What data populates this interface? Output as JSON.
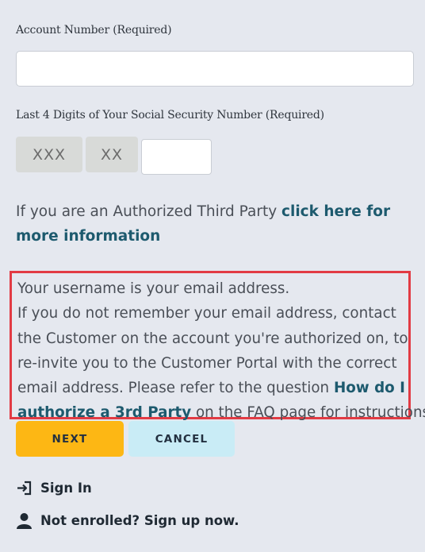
{
  "form": {
    "account_label": "Account Number (Required)",
    "ssn_label": "Last 4 Digits of Your Social Security Number (Required)",
    "ssn_mask_1": "XXX",
    "ssn_mask_2": "XX"
  },
  "third_party": {
    "text": "If you are an Authorized Third Party ",
    "link": "click here for more information"
  },
  "info": {
    "line1": "Your username is your email address.",
    "line2": "If you do not remember your email address, contact",
    "line3": "the Customer on the account you're authorized on, to",
    "line4": "re-invite you to the Customer Portal with the correct",
    "line5_text": "email address. Please refer to the question ",
    "line5_link": "How do I",
    "line6_link": "authorize a 3rd Party",
    "line6_text": " on the FAQ page for instructions",
    "border_color": "#e23b44"
  },
  "buttons": {
    "next": "NEXT",
    "cancel": "CANCEL",
    "next_color": "#fdb714",
    "cancel_color": "#c9ecf6"
  },
  "links": {
    "sign_in": "Sign In",
    "sign_in_icon": "login-arrow-icon",
    "sign_up": "Not enrolled? Sign up now.",
    "sign_up_icon": "user-icon"
  }
}
